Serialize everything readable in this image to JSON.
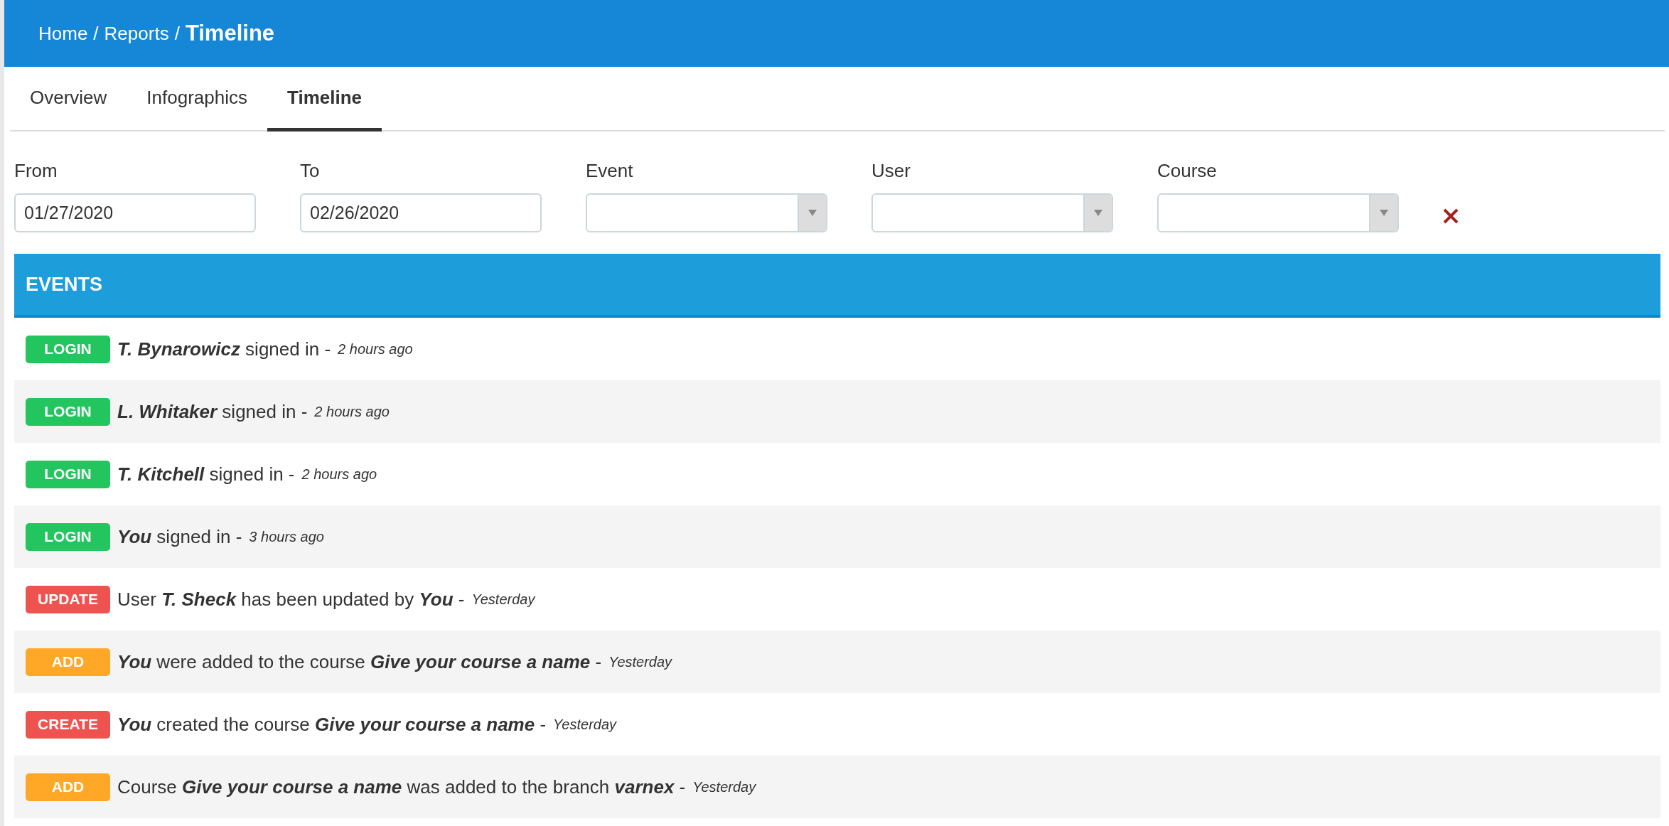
{
  "breadcrumb_separator": "/",
  "breadcrumb": [
    {
      "label": "Home",
      "current": false
    },
    {
      "label": "Reports",
      "current": false
    },
    {
      "label": "Timeline",
      "current": true
    }
  ],
  "tabs": [
    {
      "label": "Overview",
      "selected": false
    },
    {
      "label": "Infographics",
      "selected": false
    },
    {
      "label": "Timeline",
      "selected": true
    }
  ],
  "filters": [
    {
      "kind": "date",
      "label": "From",
      "value": "01/27/2020"
    },
    {
      "kind": "date",
      "label": "To",
      "value": "02/26/2020"
    },
    {
      "kind": "select",
      "label": "Event"
    },
    {
      "kind": "select",
      "label": "User"
    },
    {
      "kind": "select",
      "label": "Course"
    }
  ],
  "events_panel": {
    "title": "EVENTS",
    "rows": [
      {
        "badge": "LOGIN",
        "color": "#22c55e",
        "text": "*T. Bynarowicz* signed in -",
        "time": "2 hours ago"
      },
      {
        "badge": "LOGIN",
        "color": "#22c55e",
        "text": "*L. Whitaker* signed in -",
        "time": "2 hours ago"
      },
      {
        "badge": "LOGIN",
        "color": "#22c55e",
        "text": "*T. Kitchell* signed in -",
        "time": "2 hours ago"
      },
      {
        "badge": "LOGIN",
        "color": "#22c55e",
        "text": "*You* signed in -",
        "time": "3 hours ago"
      },
      {
        "badge": "UPDATE",
        "color": "#ef5350",
        "text": "User *T. Sheck* has been updated by *You* -",
        "time": "Yesterday"
      },
      {
        "badge": "ADD",
        "color": "#ffa726",
        "text": "*You* were added to the course *Give your course a name* -",
        "time": "Yesterday"
      },
      {
        "badge": "CREATE",
        "color": "#ef5350",
        "text": "*You* created the course *Give your course a name* -",
        "time": "Yesterday"
      },
      {
        "badge": "ADD",
        "color": "#ffa726",
        "text": "Course *Give your course a name* was added to the branch *varnex* -",
        "time": "Yesterday"
      }
    ]
  }
}
